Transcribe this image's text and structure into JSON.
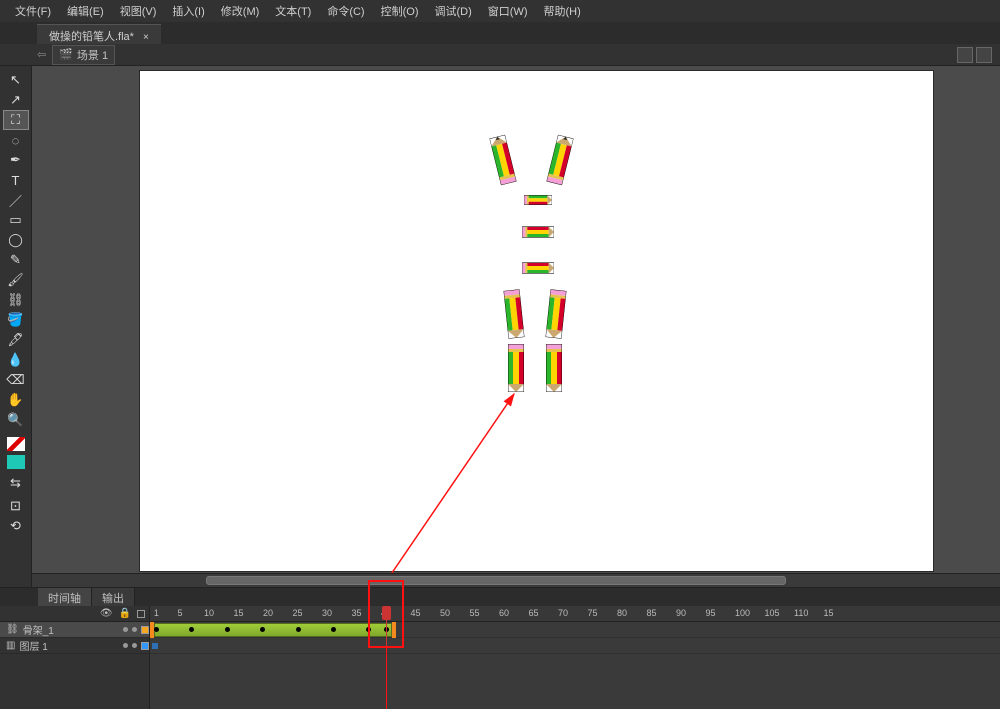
{
  "menu": {
    "file": "文件(F)",
    "edit": "编辑(E)",
    "view": "视图(V)",
    "insert": "插入(I)",
    "modify": "修改(M)",
    "text": "文本(T)",
    "commands": "命令(C)",
    "control": "控制(O)",
    "debug": "调试(D)",
    "window": "窗口(W)",
    "help": "帮助(H)"
  },
  "document": {
    "file_tab": "做操的铅笔人.fla*",
    "scene_label": "场景 1"
  },
  "timeline": {
    "tab_timeline": "时间轴",
    "tab_output": "输出",
    "layers": [
      {
        "name": "骨架_1",
        "selected": true
      },
      {
        "name": "图层 1",
        "selected": false
      }
    ],
    "ruler_marks": [
      1,
      5,
      10,
      15,
      20,
      25,
      30,
      35,
      40,
      45,
      50,
      55,
      60,
      65,
      70,
      75,
      80,
      85,
      90,
      95,
      100,
      105,
      110
    ],
    "ruler_tail": "15",
    "playhead_frame": 40,
    "span_end_frame": 41,
    "keyframes": [
      1,
      7,
      13,
      19,
      25,
      31,
      37,
      40
    ]
  },
  "callout": {
    "highlight_frame": 40
  }
}
